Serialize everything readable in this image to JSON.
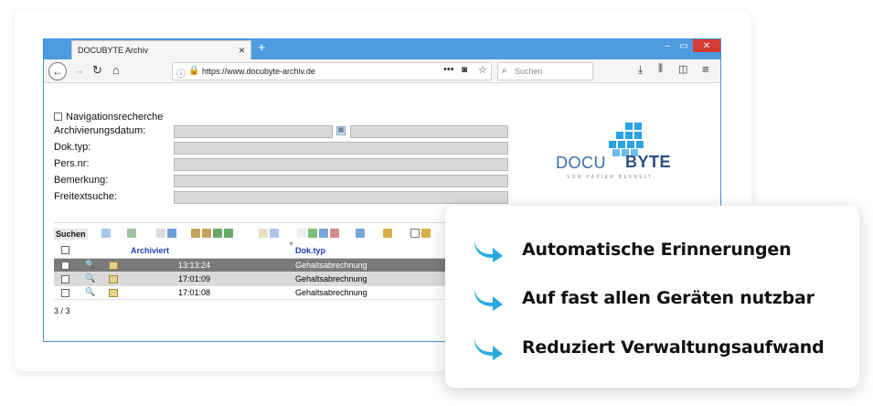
{
  "browser": {
    "tab_title": "DOCUBYTE Archiv",
    "tab_close": "×",
    "new_tab": "+",
    "url": "https://www.docubyte-archiv.de",
    "search_placeholder": "Suchen",
    "window_controls": [
      "minimize",
      "maximize",
      "close"
    ]
  },
  "form": {
    "nav_check_label": "Navigationsrecherche",
    "fields": [
      {
        "label": "Archivierungsdatum:"
      },
      {
        "label": "Dok.typ:"
      },
      {
        "label": "Pers.nr:"
      },
      {
        "label": "Bemerkung:"
      },
      {
        "label": "Freitextsuche:"
      }
    ]
  },
  "logo": {
    "docu": "DOCU",
    "byte": "BYTE",
    "tagline": "VON PAPIER BEFREIT"
  },
  "toolbar": {
    "search_label": "Suchen"
  },
  "table": {
    "headers": {
      "archived": "Archiviert",
      "doctype": "Dok.typ"
    },
    "rows": [
      {
        "time": "13:13:24",
        "doctype": "Gehaltsabrechnung",
        "selected": true
      },
      {
        "time": "17:01:09",
        "doctype": "Gehaltsabrechnung",
        "selected": false
      },
      {
        "time": "17:01:08",
        "doctype": "Gehaltsabrechnung",
        "selected": false
      }
    ],
    "count": "3 / 3"
  },
  "features": [
    "Automatische Erinnerungen",
    "Auf fast allen Geräten nutzbar",
    "Reduziert Verwaltungsaufwand"
  ],
  "colors": {
    "accent": "#29abe2",
    "titlebar": "#4d9be0",
    "link_blue": "#1f3fb5"
  }
}
